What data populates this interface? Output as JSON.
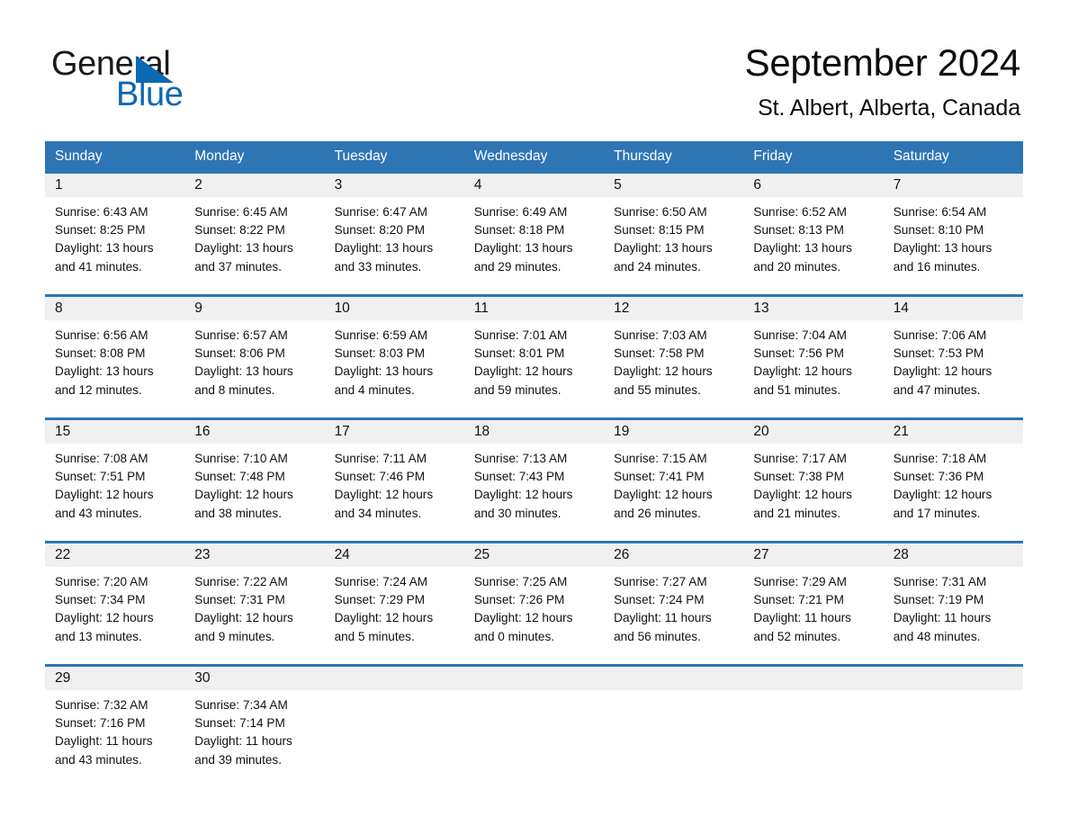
{
  "brand": {
    "word_one": "General",
    "word_two": "Blue",
    "triangle_icon": "brand-triangle-icon"
  },
  "header": {
    "month_title": "September 2024",
    "location": "St. Albert, Alberta, Canada"
  },
  "calendar": {
    "weekdays": [
      "Sunday",
      "Monday",
      "Tuesday",
      "Wednesday",
      "Thursday",
      "Friday",
      "Saturday"
    ],
    "colors": {
      "header_blue": "#2e75b6",
      "date_band_gray": "#f0f0f0",
      "brand_blue": "#0c68b0",
      "text": "#111111"
    },
    "weeks": [
      {
        "days": [
          {
            "date": "1",
            "sunrise": "Sunrise: 6:43 AM",
            "sunset": "Sunset: 8:25 PM",
            "daylight": "Daylight: 13 hours and 41 minutes."
          },
          {
            "date": "2",
            "sunrise": "Sunrise: 6:45 AM",
            "sunset": "Sunset: 8:22 PM",
            "daylight": "Daylight: 13 hours and 37 minutes."
          },
          {
            "date": "3",
            "sunrise": "Sunrise: 6:47 AM",
            "sunset": "Sunset: 8:20 PM",
            "daylight": "Daylight: 13 hours and 33 minutes."
          },
          {
            "date": "4",
            "sunrise": "Sunrise: 6:49 AM",
            "sunset": "Sunset: 8:18 PM",
            "daylight": "Daylight: 13 hours and 29 minutes."
          },
          {
            "date": "5",
            "sunrise": "Sunrise: 6:50 AM",
            "sunset": "Sunset: 8:15 PM",
            "daylight": "Daylight: 13 hours and 24 minutes."
          },
          {
            "date": "6",
            "sunrise": "Sunrise: 6:52 AM",
            "sunset": "Sunset: 8:13 PM",
            "daylight": "Daylight: 13 hours and 20 minutes."
          },
          {
            "date": "7",
            "sunrise": "Sunrise: 6:54 AM",
            "sunset": "Sunset: 8:10 PM",
            "daylight": "Daylight: 13 hours and 16 minutes."
          }
        ]
      },
      {
        "days": [
          {
            "date": "8",
            "sunrise": "Sunrise: 6:56 AM",
            "sunset": "Sunset: 8:08 PM",
            "daylight": "Daylight: 13 hours and 12 minutes."
          },
          {
            "date": "9",
            "sunrise": "Sunrise: 6:57 AM",
            "sunset": "Sunset: 8:06 PM",
            "daylight": "Daylight: 13 hours and 8 minutes."
          },
          {
            "date": "10",
            "sunrise": "Sunrise: 6:59 AM",
            "sunset": "Sunset: 8:03 PM",
            "daylight": "Daylight: 13 hours and 4 minutes."
          },
          {
            "date": "11",
            "sunrise": "Sunrise: 7:01 AM",
            "sunset": "Sunset: 8:01 PM",
            "daylight": "Daylight: 12 hours and 59 minutes."
          },
          {
            "date": "12",
            "sunrise": "Sunrise: 7:03 AM",
            "sunset": "Sunset: 7:58 PM",
            "daylight": "Daylight: 12 hours and 55 minutes."
          },
          {
            "date": "13",
            "sunrise": "Sunrise: 7:04 AM",
            "sunset": "Sunset: 7:56 PM",
            "daylight": "Daylight: 12 hours and 51 minutes."
          },
          {
            "date": "14",
            "sunrise": "Sunrise: 7:06 AM",
            "sunset": "Sunset: 7:53 PM",
            "daylight": "Daylight: 12 hours and 47 minutes."
          }
        ]
      },
      {
        "days": [
          {
            "date": "15",
            "sunrise": "Sunrise: 7:08 AM",
            "sunset": "Sunset: 7:51 PM",
            "daylight": "Daylight: 12 hours and 43 minutes."
          },
          {
            "date": "16",
            "sunrise": "Sunrise: 7:10 AM",
            "sunset": "Sunset: 7:48 PM",
            "daylight": "Daylight: 12 hours and 38 minutes."
          },
          {
            "date": "17",
            "sunrise": "Sunrise: 7:11 AM",
            "sunset": "Sunset: 7:46 PM",
            "daylight": "Daylight: 12 hours and 34 minutes."
          },
          {
            "date": "18",
            "sunrise": "Sunrise: 7:13 AM",
            "sunset": "Sunset: 7:43 PM",
            "daylight": "Daylight: 12 hours and 30 minutes."
          },
          {
            "date": "19",
            "sunrise": "Sunrise: 7:15 AM",
            "sunset": "Sunset: 7:41 PM",
            "daylight": "Daylight: 12 hours and 26 minutes."
          },
          {
            "date": "20",
            "sunrise": "Sunrise: 7:17 AM",
            "sunset": "Sunset: 7:38 PM",
            "daylight": "Daylight: 12 hours and 21 minutes."
          },
          {
            "date": "21",
            "sunrise": "Sunrise: 7:18 AM",
            "sunset": "Sunset: 7:36 PM",
            "daylight": "Daylight: 12 hours and 17 minutes."
          }
        ]
      },
      {
        "days": [
          {
            "date": "22",
            "sunrise": "Sunrise: 7:20 AM",
            "sunset": "Sunset: 7:34 PM",
            "daylight": "Daylight: 12 hours and 13 minutes."
          },
          {
            "date": "23",
            "sunrise": "Sunrise: 7:22 AM",
            "sunset": "Sunset: 7:31 PM",
            "daylight": "Daylight: 12 hours and 9 minutes."
          },
          {
            "date": "24",
            "sunrise": "Sunrise: 7:24 AM",
            "sunset": "Sunset: 7:29 PM",
            "daylight": "Daylight: 12 hours and 5 minutes."
          },
          {
            "date": "25",
            "sunrise": "Sunrise: 7:25 AM",
            "sunset": "Sunset: 7:26 PM",
            "daylight": "Daylight: 12 hours and 0 minutes."
          },
          {
            "date": "26",
            "sunrise": "Sunrise: 7:27 AM",
            "sunset": "Sunset: 7:24 PM",
            "daylight": "Daylight: 11 hours and 56 minutes."
          },
          {
            "date": "27",
            "sunrise": "Sunrise: 7:29 AM",
            "sunset": "Sunset: 7:21 PM",
            "daylight": "Daylight: 11 hours and 52 minutes."
          },
          {
            "date": "28",
            "sunrise": "Sunrise: 7:31 AM",
            "sunset": "Sunset: 7:19 PM",
            "daylight": "Daylight: 11 hours and 48 minutes."
          }
        ]
      },
      {
        "days": [
          {
            "date": "29",
            "sunrise": "Sunrise: 7:32 AM",
            "sunset": "Sunset: 7:16 PM",
            "daylight": "Daylight: 11 hours and 43 minutes."
          },
          {
            "date": "30",
            "sunrise": "Sunrise: 7:34 AM",
            "sunset": "Sunset: 7:14 PM",
            "daylight": "Daylight: 11 hours and 39 minutes."
          },
          {
            "date": "",
            "sunrise": "",
            "sunset": "",
            "daylight": ""
          },
          {
            "date": "",
            "sunrise": "",
            "sunset": "",
            "daylight": ""
          },
          {
            "date": "",
            "sunrise": "",
            "sunset": "",
            "daylight": ""
          },
          {
            "date": "",
            "sunrise": "",
            "sunset": "",
            "daylight": ""
          },
          {
            "date": "",
            "sunrise": "",
            "sunset": "",
            "daylight": ""
          }
        ]
      }
    ]
  }
}
